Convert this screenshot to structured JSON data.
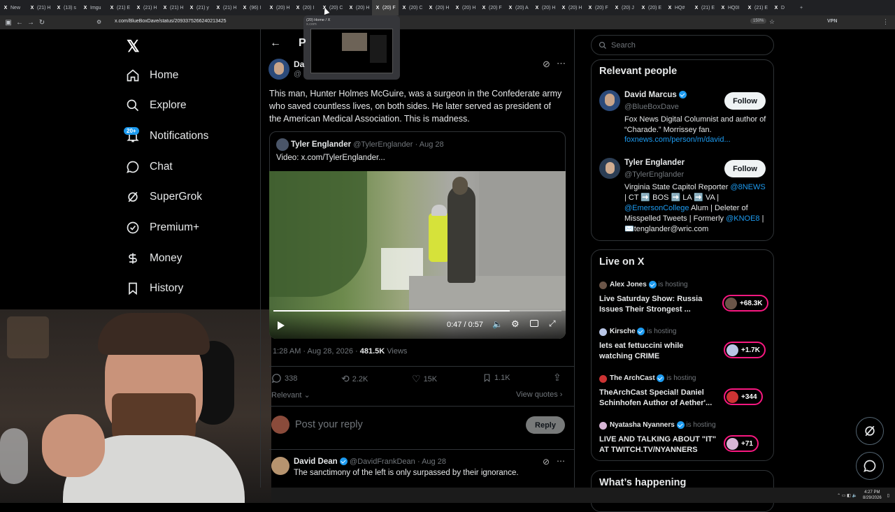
{
  "browser": {
    "tabs": [
      "New",
      "(21) H",
      "(13) s",
      "Imgu",
      "(21) E",
      "(21) H",
      "(21) H",
      "(21) y",
      "(21) H",
      "(96) I",
      "(20) H",
      "(20) I",
      "(20) C",
      "(20) H",
      "(20) F",
      "(20) C",
      "(20) H",
      "(20) H",
      "(20) F",
      "(20) A",
      "(20) H",
      "(20) H",
      "(20) F",
      "(20) J",
      "(20) E",
      "HQ#",
      "(21) E",
      "HQ0I",
      "(21) E",
      "D"
    ],
    "active_tab_index": 14,
    "url": "x.com/BlueBoxDave/status/2093375266240213425",
    "zoom": "150%",
    "vpn": "VPN",
    "tab_preview": {
      "title": "(20) Home / X",
      "domain": "x.com"
    }
  },
  "sidebar": {
    "items": [
      {
        "label": "Home",
        "icon": "home-icon"
      },
      {
        "label": "Explore",
        "icon": "search-icon"
      },
      {
        "label": "Notifications",
        "icon": "bell-icon",
        "badge": "20+"
      },
      {
        "label": "Chat",
        "icon": "chat-icon"
      },
      {
        "label": "SuperGrok",
        "icon": "grok-icon"
      },
      {
        "label": "Premium+",
        "icon": "premium-icon"
      },
      {
        "label": "Money",
        "icon": "money-icon"
      },
      {
        "label": "History",
        "icon": "bookmark-icon"
      }
    ]
  },
  "post": {
    "header_initial": "P",
    "author_name_partial": "Da",
    "author_handle_partial": "@",
    "text": "This man, Hunter Holmes McGuire, was a surgeon in the Confederate army who saved countless lives, on both sides. He later served as president of the American Medical Association. This is madness.",
    "quote": {
      "name": "Tyler Englander",
      "handle": "@TylerEnglander",
      "date": "· Aug 28",
      "text": "Video:  x.com/TylerEnglander..."
    },
    "video": {
      "time": "0:47 / 0:57",
      "progress": 0.82
    },
    "timestamp": "1:28 AM · Aug 28, 2026 · ",
    "views_count": "481.5K",
    "views_label": " Views",
    "stats": {
      "replies": "338",
      "reposts": "2.2K",
      "likes": "15K",
      "bookmarks": "1.1K"
    },
    "sort_label": "Relevant",
    "view_quotes": "View quotes",
    "reply_placeholder": "Post your reply",
    "reply_button": "Reply"
  },
  "reply": {
    "name": "David Dean",
    "handle": "@DavidFrankDean",
    "date": "· Aug 28",
    "text": "The sanctimony of the left is only surpassed by their ignorance."
  },
  "search": {
    "placeholder": "Search"
  },
  "relevant_people": {
    "title": "Relevant people",
    "people": [
      {
        "name": "David Marcus",
        "handle": "@BlueBoxDave",
        "follow": "Follow",
        "bio": "Fox News Digital Columnist and author of “Charade.” Morrissey fan.",
        "link": "foxnews.com/person/m/david..."
      },
      {
        "name": "Tyler Englander",
        "handle": "@TylerEnglander",
        "follow": "Follow",
        "bio1": "Virginia State Capitol Reporter ",
        "bio_link1": "@8NEWS",
        "bio2": " | CT ➡️ BOS ➡️ LA ➡️ VA | ",
        "bio_link2": "@EmersonCollege",
        "bio3": " Alum | Deleter of Misspelled Tweets | Formerly ",
        "bio_link3": "@KNOE8",
        "bio4": " | ✉️tenglander@wric.com"
      }
    ]
  },
  "live": {
    "title": "Live on X",
    "items": [
      {
        "host": "Alex Jones",
        "status": "is hosting",
        "title": "Live Saturday Show: Russia Issues Their Strongest ...",
        "count": "+68.3K"
      },
      {
        "host": "Kirsche",
        "status": "is hosting",
        "title": "lets eat fettuccini while watching CRIME",
        "count": "+1.7K"
      },
      {
        "host": "The ArchCast",
        "status": "is hosting",
        "title": "TheArchCast Special! Daniel Schinhofen Author of Aether'...",
        "count": "+344"
      },
      {
        "host": "Nyatasha Nyanners",
        "status": "is hosting",
        "title": "LIVE AND TALKING ABOUT \"IT\" AT TWITCH.TV/NYANNERS",
        "count": "+71"
      }
    ]
  },
  "happening": {
    "title": "What’s happening"
  },
  "taskbar": {
    "time": "4:27 PM",
    "date": "8/29/2026"
  }
}
